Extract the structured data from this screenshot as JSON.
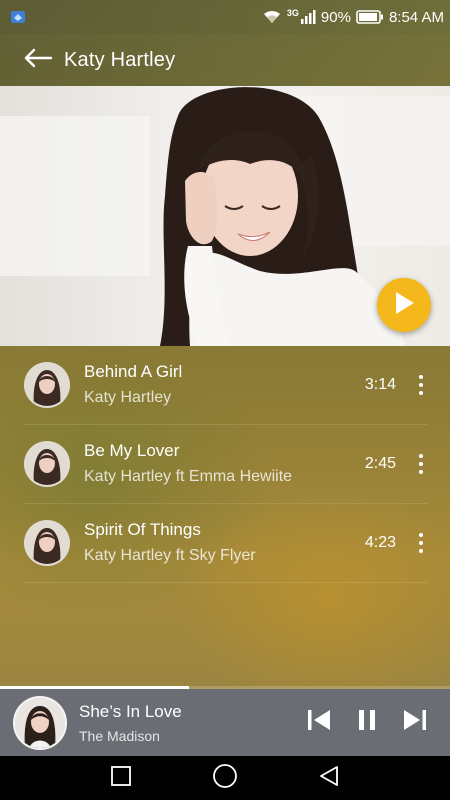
{
  "status": {
    "network": "3G",
    "battery": "90%",
    "time": "8:54 AM"
  },
  "header": {
    "title": "Katy Hartley",
    "back_icon": "arrow-left-icon"
  },
  "hero": {
    "play_icon": "play-icon",
    "accent": "#f4b81c"
  },
  "tracks": [
    {
      "title": "Behind A Girl",
      "artist": "Katy Hartley",
      "duration": "3:14"
    },
    {
      "title": "Be My Lover",
      "artist": "Katy Hartley ft Emma Hewiite",
      "duration": "2:45"
    },
    {
      "title": "Spirit Of Things",
      "artist": "Katy Hartley ft Sky Flyer",
      "duration": "4:23"
    }
  ],
  "player": {
    "title": "She’s In Love",
    "artist": "The Madison",
    "progress": 0.42,
    "controls": [
      "skip-previous-icon",
      "pause-icon",
      "skip-next-icon"
    ]
  },
  "nav": {
    "buttons": [
      "recents-square-icon",
      "home-circle-icon",
      "back-triangle-icon"
    ]
  }
}
